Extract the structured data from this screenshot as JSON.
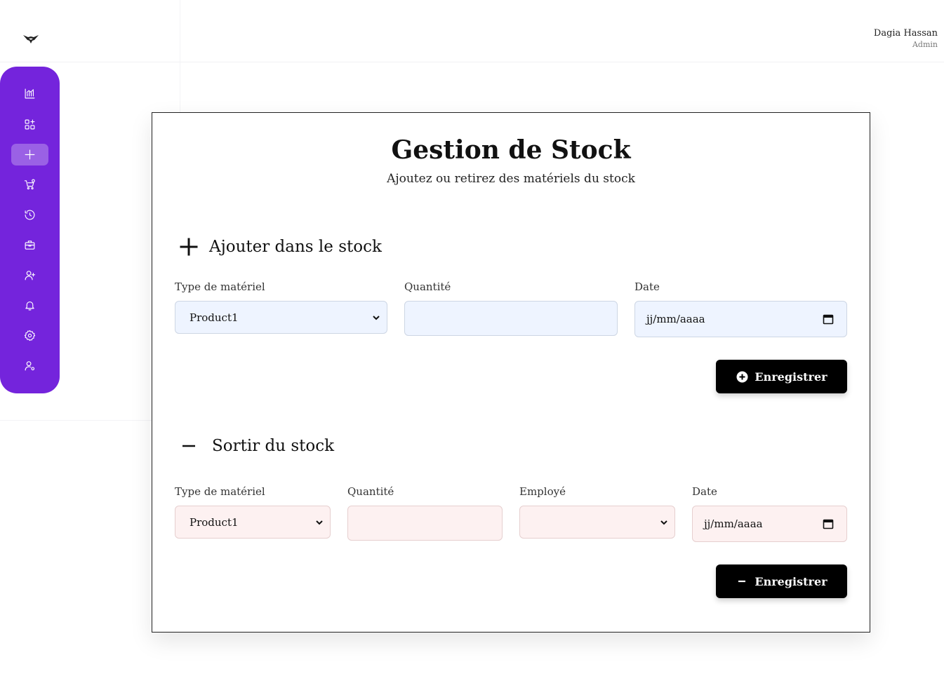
{
  "header": {
    "logo_icon": "bird-logo-icon",
    "user_name": "Dagia Hassan",
    "user_role": "Admin"
  },
  "sidebar": {
    "accent": "#7424dc",
    "items": [
      {
        "icon": "chart-icon",
        "active": false
      },
      {
        "icon": "apps-add-icon",
        "active": false
      },
      {
        "icon": "plus-icon",
        "active": true
      },
      {
        "icon": "cart-icon",
        "active": false
      },
      {
        "icon": "history-icon",
        "active": false
      },
      {
        "icon": "briefcase-icon",
        "active": false
      },
      {
        "icon": "user-add-icon",
        "active": false
      },
      {
        "icon": "bell-icon",
        "active": false
      },
      {
        "icon": "gear-icon",
        "active": false
      },
      {
        "icon": "user-settings-icon",
        "active": false
      }
    ]
  },
  "page": {
    "title": "Gestion de Stock",
    "subtitle": "Ajoutez ou retirez des matériels du stock"
  },
  "add_section": {
    "icon": "plus-icon",
    "title": "Ajouter dans le stock",
    "type_label": "Type de matériel",
    "type_value": "Product1",
    "quantity_label": "Quantité",
    "quantity_value": "",
    "date_label": "Date",
    "date_value": "jj/mm/aaaa",
    "save_label": "Enregistrer",
    "save_icon": "plus-circle-icon",
    "field_color": "#eef4ff"
  },
  "remove_section": {
    "icon": "minus-icon",
    "title": "Sortir du stock",
    "type_label": "Type de matériel",
    "type_value": "Product1",
    "quantity_label": "Quantité",
    "quantity_value": "",
    "employee_label": "Employé",
    "employee_value": "",
    "date_label": "Date",
    "date_value": "jj/mm/aaaa",
    "save_label": "Enregistrer",
    "save_icon": "minus-icon",
    "field_color": "#fdf1f1"
  }
}
